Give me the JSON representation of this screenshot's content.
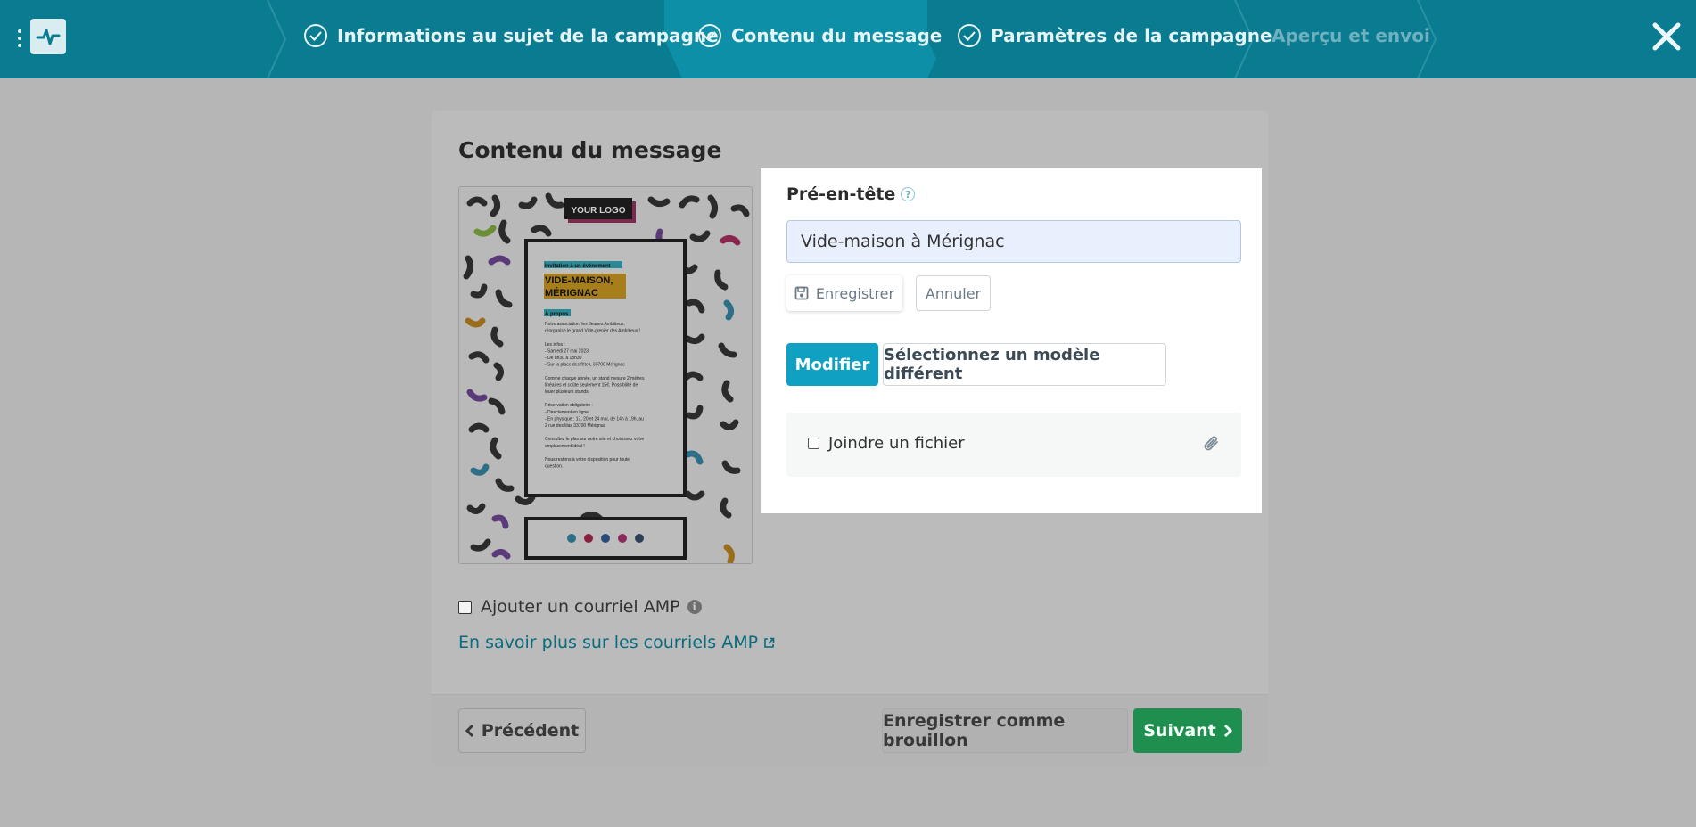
{
  "steps": [
    {
      "label": "Informations au sujet de la campagne",
      "state": "done"
    },
    {
      "label": "Contenu du message",
      "state": "current"
    },
    {
      "label": "Paramètres de la campagne",
      "state": "done"
    },
    {
      "label": "Aperçu et envoi",
      "state": "future"
    }
  ],
  "card": {
    "title": "Contenu du message"
  },
  "preview": {
    "logo_text": "YOUR LOGO",
    "eyebrow": "Invitation à un événement",
    "headline_1": "VIDE-MAISON,",
    "headline_2": "MÉRIGNAC",
    "section_label": "À propos",
    "body": [
      "Notre association, les Jeunes Ambitieux,",
      "réorganise le grand Vide-grenier des Ambitieux !",
      "",
      "Les infos :",
      "- Samedi 27 mai 2023",
      "- De 8h30 à 18h30",
      "- Sur la place des fêtes, 33700 Mérignac",
      "",
      "Comme chaque année, un stand mesure 2 mètres",
      "linéaires et coûte seulement 15€. Possibilité de",
      "louer plusieurs stands.",
      "",
      "Réservation obligatoire :",
      "- Directement en ligne",
      "- En physique : 17, 20 et 24 mai, de 14h à 19h, au",
      "2 rue des lilas 33700 Mérignac",
      "",
      "Consultez le plan sur notre site et choisissez votre",
      "emplacement idéal !",
      "",
      "Nous restons à votre disposition pour toute",
      "question."
    ]
  },
  "amp": {
    "checkbox_label": "Ajouter un courriel AMP",
    "checked": false,
    "learn_more": "En savoir plus sur les courriels AMP"
  },
  "preheader": {
    "label": "Pré-en-tête",
    "value": "Vide-maison à Mérignac",
    "save_label": "Enregistrer",
    "cancel_label": "Annuler"
  },
  "actions": {
    "modify_label": "Modifier",
    "template_label": "Sélectionnez un modèle différent"
  },
  "attachment": {
    "label": "Joindre un fichier",
    "checked": false
  },
  "footer": {
    "prev_label": "Précédent",
    "draft_label": "Enregistrer comme brouillon",
    "next_label": "Suivant"
  },
  "colors": {
    "topbar": "#0a7c92",
    "current_step": "#0e8fa8",
    "primary": "#0fa0c2",
    "success": "#1f8f4f",
    "overlay": "#b6b6b6"
  }
}
